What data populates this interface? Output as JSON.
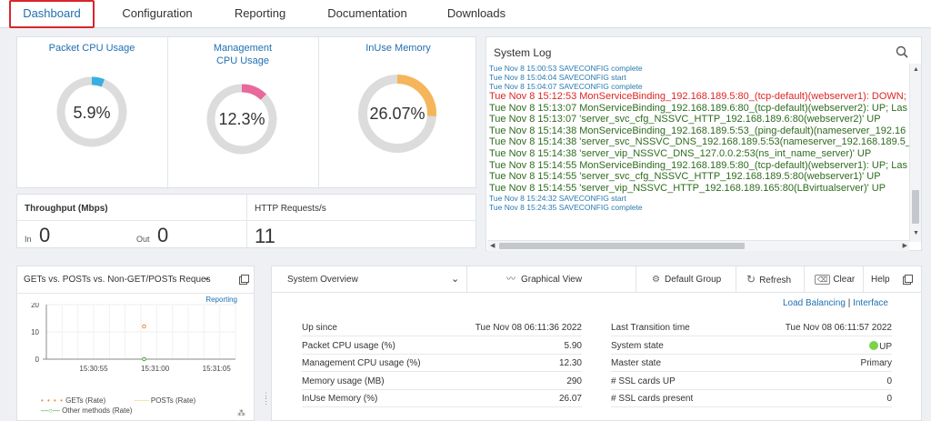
{
  "nav": {
    "tabs": [
      {
        "label": "Dashboard",
        "active": true
      },
      {
        "label": "Configuration"
      },
      {
        "label": "Reporting"
      },
      {
        "label": "Documentation"
      },
      {
        "label": "Downloads"
      }
    ]
  },
  "gauges": [
    {
      "title": "Packet CPU Usage",
      "value": "5.9%",
      "percent": 5.9,
      "color": "#3aaee0"
    },
    {
      "title": "Management CPU Usage",
      "value": "12.3%",
      "percent": 12.3,
      "color": "#e8699a"
    },
    {
      "title": "InUse Memory",
      "value": "26.07%",
      "percent": 26.07,
      "color": "#f5b55a"
    }
  ],
  "throughput": {
    "label": "Throughput (Mbps)",
    "in_label": "In",
    "in_value": "0",
    "out_label": "Out",
    "out_value": "0"
  },
  "http": {
    "label": "HTTP Requests/s",
    "value": "11"
  },
  "syslog": {
    "title": "System Log",
    "lines": [
      {
        "text": "Tue Nov 8 15:00:53 SAVECONFIG complete",
        "color": "#2a7ab0",
        "small": true
      },
      {
        "text": "Tue Nov 8 15:04:04 SAVECONFIG start",
        "color": "#2a7ab0",
        "small": true
      },
      {
        "text": "Tue Nov 8 15:04:07 SAVECONFIG complete",
        "color": "#2a7ab0",
        "small": true
      },
      {
        "text": "Tue Nov 8 15:12:53 MonServiceBinding_192.168.189.5:80_(tcp-default)(webserver1): DOWN;",
        "color": "#e02424"
      },
      {
        "text": "Tue Nov 8 15:13:07 MonServiceBinding_192.168.189.6:80_(tcp-default)(webserver2): UP; Las",
        "color": "#2e6b1e"
      },
      {
        "text": "Tue Nov 8 15:13:07 'server_svc_cfg_NSSVC_HTTP_192.168.189.6:80(webserver2)' UP",
        "color": "#2e6b1e"
      },
      {
        "text": "Tue Nov 8 15:14:38 MonServiceBinding_192.168.189.5:53_(ping-default)(nameserver_192.16",
        "color": "#2e6b1e"
      },
      {
        "text": "Tue Nov 8 15:14:38 'server_svc_NSSVC_DNS_192.168.189.5:53(nameserver_192.168.189.5_5",
        "color": "#2e6b1e"
      },
      {
        "text": "Tue Nov 8 15:14:38 'server_vip_NSSVC_DNS_127.0.0.2:53(ns_int_name_server)' UP",
        "color": "#2e6b1e"
      },
      {
        "text": "Tue Nov 8 15:14:55 MonServiceBinding_192.168.189.5:80_(tcp-default)(webserver1): UP; Las",
        "color": "#2e6b1e"
      },
      {
        "text": "Tue Nov 8 15:14:55 'server_svc_cfg_NSSVC_HTTP_192.168.189.5:80(webserver1)' UP",
        "color": "#2e6b1e"
      },
      {
        "text": "Tue Nov 8 15:14:55 'server_vip_NSSVC_HTTP_192.168.189.165:80(LBvirtualserver)' UP",
        "color": "#2e6b1e"
      },
      {
        "text": "Tue Nov 8 15:24:32 SAVECONFIG start",
        "color": "#2a7ab0",
        "small": true
      },
      {
        "text": "Tue Nov 8 15:24:35 SAVECONFIG complete",
        "color": "#2a7ab0",
        "small": true
      }
    ]
  },
  "gets_chart": {
    "title": "GETs vs. POSTs vs. Non-GET/POSTs Reques",
    "reporting_link": "Reporting",
    "legend": [
      "GETs (Rate)",
      "POSTs (Rate)",
      "Other methods (Rate)"
    ]
  },
  "chart_data": {
    "type": "line",
    "x": [
      "15:30:55",
      "15:31:00",
      "15:31:05"
    ],
    "ylim": [
      0,
      20
    ],
    "yticks": [
      "0",
      "10",
      "20"
    ],
    "series": [
      {
        "name": "GETs (Rate)",
        "color": "#f08a3c",
        "points": [
          [
            15.5,
            12
          ]
        ]
      },
      {
        "name": "POSTs (Rate)",
        "color": "#f0c23c",
        "points": []
      },
      {
        "name": "Other methods (Rate)",
        "color": "#3aa63a",
        "points": [
          [
            15.5,
            0
          ]
        ]
      }
    ],
    "xrange": [
      0,
      30
    ]
  },
  "overview": {
    "tabs": {
      "system_overview": "System Overview",
      "graphical_view": "Graphical View",
      "default_group": "Default Group",
      "refresh": "Refresh",
      "clear": "Clear",
      "help": "Help"
    },
    "links": {
      "lb": "Load Balancing",
      "sep": "|",
      "iface": "Interface"
    },
    "left": [
      {
        "k": "Up since",
        "v": "Tue Nov 08 06:11:36 2022"
      },
      {
        "k": "Packet CPU usage (%)",
        "v": "5.90"
      },
      {
        "k": "Management CPU usage (%)",
        "v": "12.30"
      },
      {
        "k": "Memory usage (MB)",
        "v": "290"
      },
      {
        "k": "InUse Memory (%)",
        "v": "26.07"
      }
    ],
    "right": [
      {
        "k": "Last Transition time",
        "v": "Tue Nov 08 06:11:57 2022"
      },
      {
        "k": "System state",
        "v": "UP"
      },
      {
        "k": "Master state",
        "v": "Primary"
      },
      {
        "k": "# SSL cards UP",
        "v": "0"
      },
      {
        "k": "# SSL cards present",
        "v": "0"
      }
    ]
  }
}
